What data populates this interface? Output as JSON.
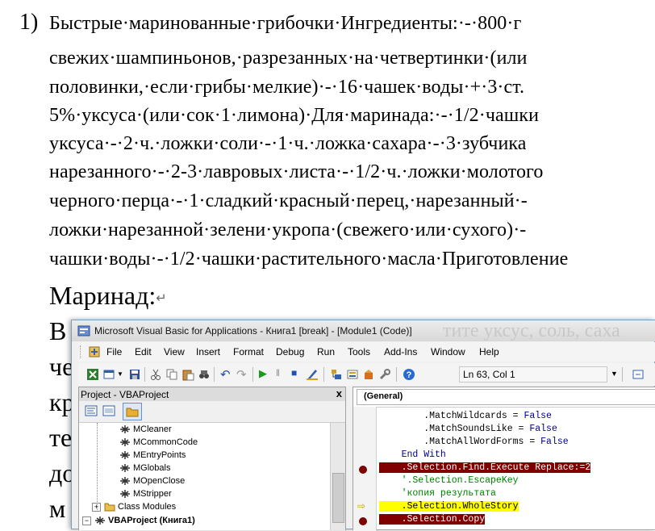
{
  "document": {
    "list_number": "1)",
    "lines": [
      "Быстрые·маринованные·грибочки·Ингредиенты:·-·800·г",
      "свежих·шампиньонов,·разрезанных·на·четвертинки·(или",
      "половинки,·если·грибы·мелкие)·-·16·чашек·воды·+·3·ст.",
      "5%·уксуса·(или·сок·1·лимона)·Для·маринада:·-·1/2·чашки",
      "уксуса·-·2·ч.·ложки·соли·-·1·ч.·ложка·сахара·-·3·зубчика",
      "нарезанного·-·2-3·лавровых·листа·-·1/2·ч.·ложки·молотого",
      "черного·перца·-·1·сладкий·красный·перец,·нарезанный·-",
      "ложки·нарезанной·зелени·укропа·(свежего·или·сухого)·-",
      "чашки·воды·-·1/2·чашки·растительного·масла·Приготовление"
    ],
    "heading": "Маринад:",
    "pilcrow": "↵",
    "cut_chars": [
      "В",
      "че",
      "кр",
      "те",
      "до",
      "м"
    ]
  },
  "vba": {
    "title": "Microsoft Visual Basic for Applications - Книга1 [break] - [Module1 (Code)]",
    "ghost_title": "тите уксус, соль, саха",
    "menu": [
      "File",
      "Edit",
      "View",
      "Insert",
      "Format",
      "Debug",
      "Run",
      "Tools",
      "Add-Ins",
      "Window",
      "Help"
    ],
    "position_indicator": "Ln 63, Col 1",
    "project_title": "Project - VBAProject",
    "project_close": "x",
    "tree": [
      {
        "label": "MCleaner"
      },
      {
        "label": "MCommonCode"
      },
      {
        "label": "MEntryPoints"
      },
      {
        "label": "MGlobals"
      },
      {
        "label": "MOpenClose"
      },
      {
        "label": "MStripper"
      },
      {
        "label": "Class Modules"
      },
      {
        "label": "VBAProject (Книга1)"
      }
    ],
    "object_combo": "(General)",
    "code": [
      "        .MatchWildcards = False",
      "        .MatchSoundsLike = False",
      "        .MatchAllWordForms = False",
      "    End With",
      "    .Selection.Find.Execute Replace:=2",
      "    '.Selection.EscapeKey",
      "    'копия результата",
      "    .Selection.WholeStory",
      "    .Selection.Copy"
    ],
    "colors": {
      "breakpoint": "#800000",
      "execution": "#ffff00",
      "keyword": "#00008b",
      "comment": "#008000"
    }
  }
}
